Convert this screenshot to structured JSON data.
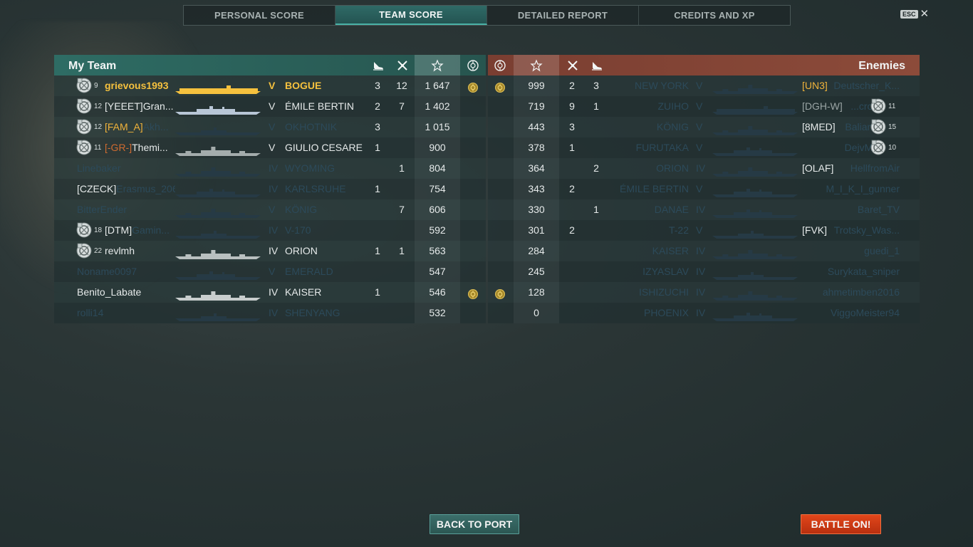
{
  "tabs": [
    {
      "label": "PERSONAL SCORE",
      "active": false
    },
    {
      "label": "TEAM SCORE",
      "active": true
    },
    {
      "label": "DETAILED REPORT",
      "active": false
    },
    {
      "label": "CREDITS AND XP",
      "active": false
    }
  ],
  "esc_label": "ESC",
  "my_team": {
    "title": "My Team",
    "players": [
      {
        "level": "9",
        "name": "grievous1993",
        "clan": "",
        "ship_tier": "V",
        "ship": "BOGUE",
        "planes": "3",
        "kills": "12",
        "xp": "1 647",
        "medal": true,
        "alive": true,
        "me": true,
        "silhouette_color": "#f5c13e",
        "type": "cv"
      },
      {
        "level": "12",
        "name": "Gran...",
        "clan": "[YEEET]",
        "ship_tier": "V",
        "ship": "ÉMILE BERTIN",
        "planes": "2",
        "kills": "7",
        "xp": "1 402",
        "medal": false,
        "alive": true,
        "me": false,
        "silhouette_color": "#b8c6d6",
        "type": "cruiser"
      },
      {
        "level": "12",
        "name": "Akh...",
        "clan": "[FAM_A]",
        "ship_tier": "V",
        "ship": "OKHOTNIK",
        "planes": "3",
        "kills": "",
        "xp": "1 015",
        "medal": false,
        "alive": false,
        "me": false,
        "silhouette_color": "#263a45",
        "type": "destroyer"
      },
      {
        "level": "11",
        "name": "Themi...",
        "clan": "[-GR-]",
        "ship_tier": "V",
        "ship": "GIULIO CESARE",
        "planes": "1",
        "kills": "",
        "xp": "900",
        "medal": false,
        "alive": true,
        "me": false,
        "silhouette_color": "#a4acac",
        "type": "battleship"
      },
      {
        "level": "",
        "name": "Linebaker",
        "clan": "",
        "ship_tier": "IV",
        "ship": "WYOMING",
        "planes": "",
        "kills": "1",
        "xp": "804",
        "medal": false,
        "alive": false,
        "me": false,
        "silhouette_color": "#263a45",
        "type": "battleship"
      },
      {
        "level": "",
        "name": "Erasmus_206",
        "clan": "[CZECK]",
        "ship_tier": "IV",
        "ship": "KARLSRUHE",
        "planes": "1",
        "kills": "",
        "xp": "754",
        "medal": false,
        "alive": false,
        "me": false,
        "silhouette_color": "#263a45",
        "type": "cruiser",
        "clan_alive": true
      },
      {
        "level": "",
        "name": "BitterEnder",
        "clan": "",
        "ship_tier": "V",
        "ship": "KÖNIG",
        "planes": "",
        "kills": "7",
        "xp": "606",
        "medal": false,
        "alive": false,
        "me": false,
        "silhouette_color": "#263a45",
        "type": "battleship"
      },
      {
        "level": "18",
        "name": "Gamin...",
        "clan": "[DTM]",
        "ship_tier": "IV",
        "ship": "V-170",
        "planes": "",
        "kills": "",
        "xp": "592",
        "medal": false,
        "alive": false,
        "me": false,
        "silhouette_color": "#263a45",
        "type": "destroyer",
        "clan_alive": true
      },
      {
        "level": "22",
        "name": "revlmh",
        "clan": "",
        "ship_tier": "IV",
        "ship": "ORION",
        "planes": "1",
        "kills": "1",
        "xp": "563",
        "medal": false,
        "alive": true,
        "me": false,
        "silhouette_color": "#b9c0c0",
        "type": "battleship"
      },
      {
        "level": "",
        "name": "Noname0097",
        "clan": "",
        "ship_tier": "V",
        "ship": "EMERALD",
        "planes": "",
        "kills": "",
        "xp": "547",
        "medal": false,
        "alive": false,
        "me": false,
        "silhouette_color": "#263a45",
        "type": "cruiser"
      },
      {
        "level": "",
        "name": "Benito_Labate",
        "clan": "",
        "ship_tier": "IV",
        "ship": "KAISER",
        "planes": "1",
        "kills": "",
        "xp": "546",
        "medal": true,
        "alive": true,
        "me": false,
        "silhouette_color": "#c8cdcd",
        "type": "battleship"
      },
      {
        "level": "",
        "name": "rolli14",
        "clan": "",
        "ship_tier": "IV",
        "ship": "SHENYANG",
        "planes": "",
        "kills": "",
        "xp": "532",
        "medal": false,
        "alive": false,
        "me": false,
        "silhouette_color": "#263a45",
        "type": "destroyer"
      }
    ]
  },
  "enemies": {
    "title": "Enemies",
    "players": [
      {
        "level": "",
        "name": "Deutscher_K...",
        "clan": "[UN3]",
        "ship_tier": "V",
        "ship": "NEW YORK",
        "planes": "3",
        "kills": "2",
        "xp": "999",
        "medal": true,
        "alive": false,
        "clan_color": "yellow",
        "type": "battleship"
      },
      {
        "level": "11",
        "name": "...cro...",
        "clan": "[DGH-W]",
        "ship_tier": "V",
        "ship": "ZUIHO",
        "planes": "1",
        "kills": "9",
        "xp": "719",
        "medal": false,
        "alive": false,
        "clan_color": "grey",
        "type": "cv"
      },
      {
        "level": "15",
        "name": "Balian...",
        "clan": "[8MED]",
        "ship_tier": "V",
        "ship": "KÖNIG",
        "planes": "",
        "kills": "3",
        "xp": "443",
        "medal": false,
        "alive": false,
        "clan_color": "white",
        "type": "battleship"
      },
      {
        "level": "10",
        "name": "DejvMM",
        "clan": "",
        "ship_tier": "V",
        "ship": "FURUTAKA",
        "planes": "",
        "kills": "1",
        "xp": "378",
        "medal": false,
        "alive": false,
        "clan_color": "",
        "type": "cruiser"
      },
      {
        "level": "",
        "name": "HellfromAir",
        "clan": "[OLAF]",
        "ship_tier": "IV",
        "ship": "ORION",
        "planes": "2",
        "kills": "",
        "xp": "364",
        "medal": false,
        "alive": false,
        "clan_color": "white",
        "type": "battleship"
      },
      {
        "level": "",
        "name": "M_I_K_I_gunner",
        "clan": "",
        "ship_tier": "V",
        "ship": "ÉMILE BERTIN",
        "planes": "",
        "kills": "2",
        "xp": "343",
        "medal": false,
        "alive": false,
        "clan_color": "",
        "type": "cruiser"
      },
      {
        "level": "",
        "name": "Baret_TV",
        "clan": "",
        "ship_tier": "IV",
        "ship": "DANAE",
        "planes": "1",
        "kills": "",
        "xp": "330",
        "medal": false,
        "alive": false,
        "clan_color": "",
        "type": "cruiser"
      },
      {
        "level": "",
        "name": "Trotsky_Was...",
        "clan": "[FVK]",
        "ship_tier": "V",
        "ship": "T-22",
        "planes": "",
        "kills": "2",
        "xp": "301",
        "medal": false,
        "alive": false,
        "clan_color": "white",
        "type": "destroyer"
      },
      {
        "level": "",
        "name": "guedi_1",
        "clan": "",
        "ship_tier": "IV",
        "ship": "KAISER",
        "planes": "",
        "kills": "",
        "xp": "284",
        "medal": false,
        "alive": false,
        "clan_color": "",
        "type": "battleship"
      },
      {
        "level": "",
        "name": "Surykata_sniper",
        "clan": "",
        "ship_tier": "IV",
        "ship": "IZYASLAV",
        "planes": "",
        "kills": "",
        "xp": "245",
        "medal": false,
        "alive": false,
        "clan_color": "",
        "type": "destroyer"
      },
      {
        "level": "",
        "name": "ahmetimben2016",
        "clan": "",
        "ship_tier": "IV",
        "ship": "ISHIZUCHI",
        "planes": "",
        "kills": "",
        "xp": "128",
        "medal": true,
        "alive": false,
        "clan_color": "",
        "type": "battleship"
      },
      {
        "level": "",
        "name": "ViggoMeister94",
        "clan": "",
        "ship_tier": "IV",
        "ship": "PHOENIX",
        "planes": "",
        "kills": "",
        "xp": "0",
        "medal": false,
        "alive": false,
        "clan_color": "",
        "type": "cruiser"
      }
    ]
  },
  "buttons": {
    "back_to_port": "BACK TO PORT",
    "battle_on": "BATTLE ON!"
  },
  "colors": {
    "my_team_header": "#2e6c64",
    "enemy_header": "#8c4b3a",
    "battle_button": "#d13c15",
    "self_highlight": "#f5c13e"
  }
}
